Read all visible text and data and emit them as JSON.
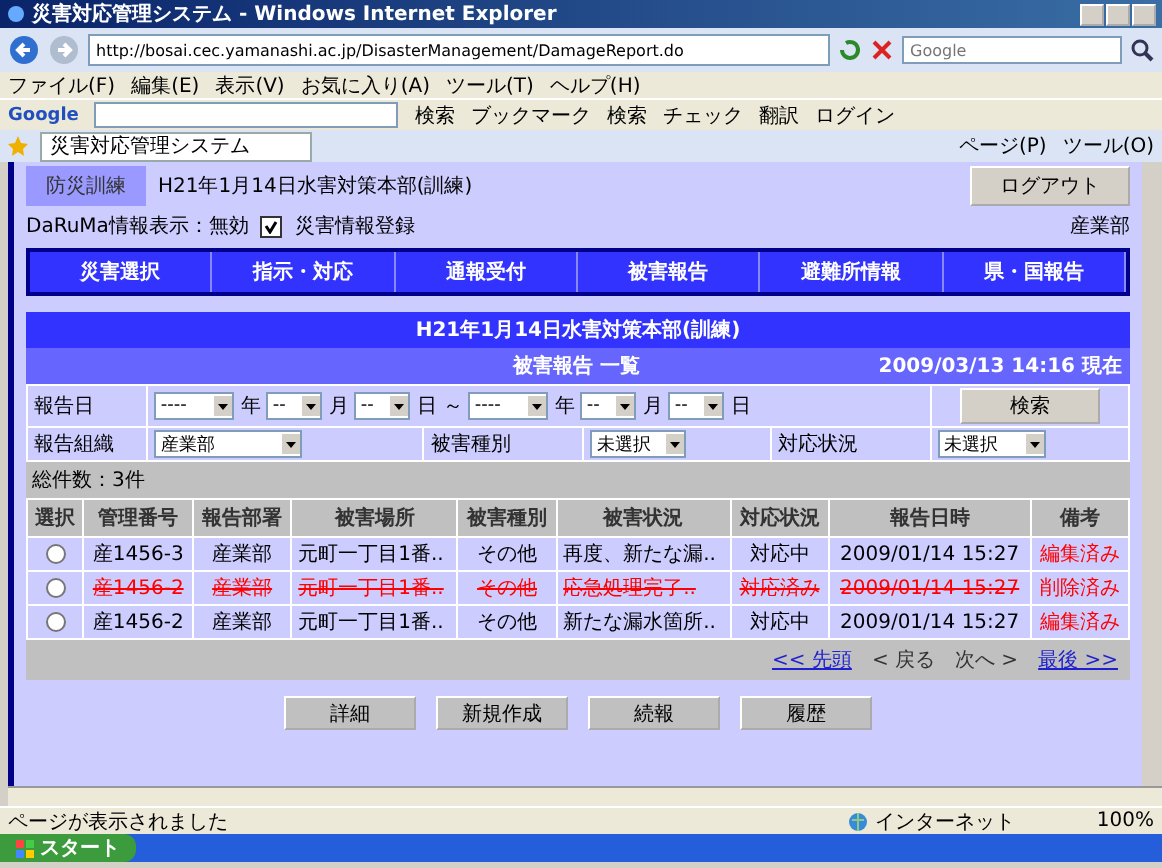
{
  "window": {
    "title": "災害対応管理システム - Windows Internet Explorer"
  },
  "address_bar": {
    "url": "http://bosai.cec.yamanashi.ac.jp/DisasterManagement/DamageReport.do",
    "search_placeholder": "Google"
  },
  "menu": [
    "ファイル(F)",
    "編集(E)",
    "表示(V)",
    "お気に入り(A)",
    "ツール(T)",
    "ヘルプ(H)"
  ],
  "toolbar": {
    "logo": "Google",
    "items": [
      "検索",
      "ブックマーク",
      "検索",
      "チェック",
      "翻訳",
      "ログイン"
    ]
  },
  "browser_tab": {
    "title": "災害対応管理システム",
    "commands": [
      "ページ(P)",
      "ツール(O)"
    ]
  },
  "header": {
    "badge": "防災訓練",
    "headquarters": "H21年1月14日水害対策本部(訓練)",
    "logout": "ログアウト",
    "daruma": "DaRuMa情報表示：無効",
    "register": {
      "label": "災害情報登録",
      "checked": true
    },
    "department": "産業部"
  },
  "nav": [
    "災害選択",
    "指示・対応",
    "通報受付",
    "被害報告",
    "避難所情報",
    "県・国報告"
  ],
  "panel": {
    "title": "H21年1月14日水害対策本部(訓練)",
    "subtitle": "被害報告 一覧",
    "timestamp": "2009/03/13 14:16 現在"
  },
  "filters": {
    "date_label": "報告日",
    "from": [
      "----",
      "年",
      "--",
      "月",
      "--",
      "日"
    ],
    "range": "～",
    "to": [
      "----",
      "年",
      "--",
      "月",
      "--",
      "日"
    ],
    "search": "検索",
    "org_label": "報告組織",
    "org": "産業部",
    "type_label": "被害種別",
    "type": "未選択",
    "status_label": "対応状況",
    "status": "未選択"
  },
  "total": "総件数：3件",
  "table": {
    "columns": [
      "選択",
      "管理番号",
      "報告部署",
      "被害場所",
      "被害種別",
      "被害状況",
      "対応状況",
      "報告日時",
      "備考"
    ],
    "rows": [
      {
        "selected": false,
        "deleted": false,
        "cells": [
          "",
          "産1456-3",
          "産業部",
          "元町一丁目1番..",
          "その他",
          "再度、新たな漏..",
          "対応中",
          "2009/01/14 15:27",
          "編集済み"
        ]
      },
      {
        "selected": false,
        "deleted": true,
        "cells": [
          "",
          "産1456-2",
          "産業部",
          "元町一丁目1番..",
          "その他",
          "応急処理完了..",
          "対応済み",
          "2009/01/14 15:27",
          "削除済み"
        ]
      },
      {
        "selected": false,
        "deleted": false,
        "cells": [
          "",
          "産1456-2",
          "産業部",
          "元町一丁目1番..",
          "その他",
          "新たな漏水箇所..",
          "対応中",
          "2009/01/14 15:27",
          "編集済み"
        ]
      }
    ]
  },
  "pager": [
    {
      "label": "<< 先頭",
      "disabled": false
    },
    {
      "label": "< 戻る",
      "disabled": true
    },
    {
      "label": "次へ >",
      "disabled": true
    },
    {
      "label": "最後 >>",
      "disabled": false
    }
  ],
  "buttons": [
    "詳細",
    "新規作成",
    "続報",
    "履歴"
  ],
  "status_bar": {
    "message": "ページが表示されました",
    "zone": "インターネット",
    "zoom": "100%"
  },
  "taskbar": {
    "start": "スタート"
  }
}
